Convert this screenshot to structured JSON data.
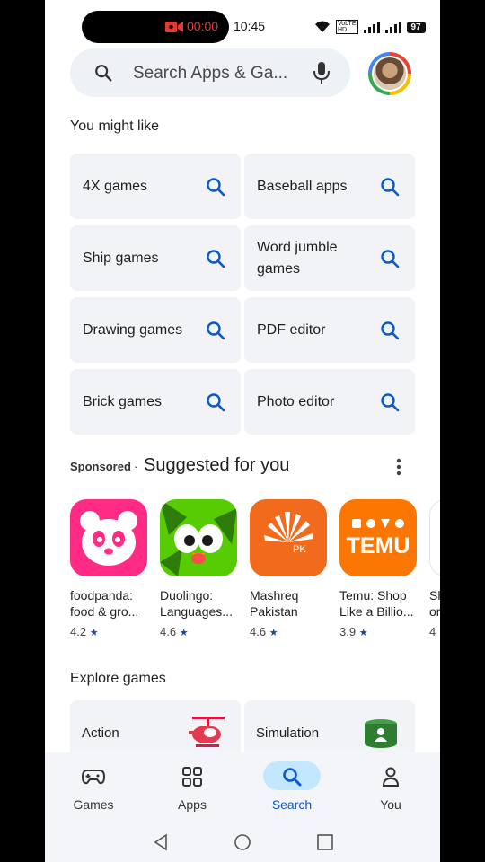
{
  "status_bar": {
    "record_time": "00:00",
    "clock": "10:45",
    "battery": "97",
    "volte_line1": "VoLTE",
    "volte_line2": "HD"
  },
  "search": {
    "placeholder": "Search Apps & Ga..."
  },
  "you_might_like": {
    "title": "You might like",
    "chips": [
      {
        "label": "4X games"
      },
      {
        "label": "Baseball apps"
      },
      {
        "label": "Ship games"
      },
      {
        "label": "Word jumble games"
      },
      {
        "label": "Drawing games"
      },
      {
        "label": "PDF editor"
      },
      {
        "label": "Brick games"
      },
      {
        "label": "Photo editor"
      }
    ]
  },
  "suggested": {
    "sponsored": "Sponsored",
    "separator": "·",
    "title": "Suggested for you",
    "apps": [
      {
        "name": "foodpanda:\nfood & gro...",
        "rating": "4.2",
        "color": "#ff2b85",
        "icon": "panda-icon"
      },
      {
        "name": "Duolingo:\nLanguages...",
        "rating": "4.6",
        "color": "#58cc02",
        "icon": "duolingo-owl-icon"
      },
      {
        "name": "Mashreq\nPakistan",
        "rating": "4.6",
        "color": "#f26b1d",
        "icon": "mashreq-logo-icon"
      },
      {
        "name": "Temu: Shop\nLike a Billio...",
        "rating": "3.9",
        "color": "#fb7701",
        "icon": "temu-logo-icon"
      },
      {
        "name": "Sh\nor",
        "rating": "4",
        "color": "#ffffff",
        "icon": "partial-app-icon"
      }
    ],
    "temu_logo_text": "TEMU",
    "mashreq_badge": "PK"
  },
  "explore_games": {
    "title": "Explore games",
    "cards": [
      {
        "label": "Action",
        "icon": "helicopter-icon"
      },
      {
        "label": "Simulation",
        "icon": "simulation-icon"
      }
    ]
  },
  "bottom_nav": {
    "items": [
      {
        "label": "Games",
        "icon": "gamepad-icon"
      },
      {
        "label": "Apps",
        "icon": "apps-grid-icon"
      },
      {
        "label": "Search",
        "icon": "search-icon",
        "active": true
      },
      {
        "label": "You",
        "icon": "person-icon"
      }
    ]
  },
  "colors": {
    "accent": "#0b57d0",
    "chip_bg": "#f1f3f6",
    "active_pill": "#c2e7ff",
    "record_red": "#e53935"
  }
}
